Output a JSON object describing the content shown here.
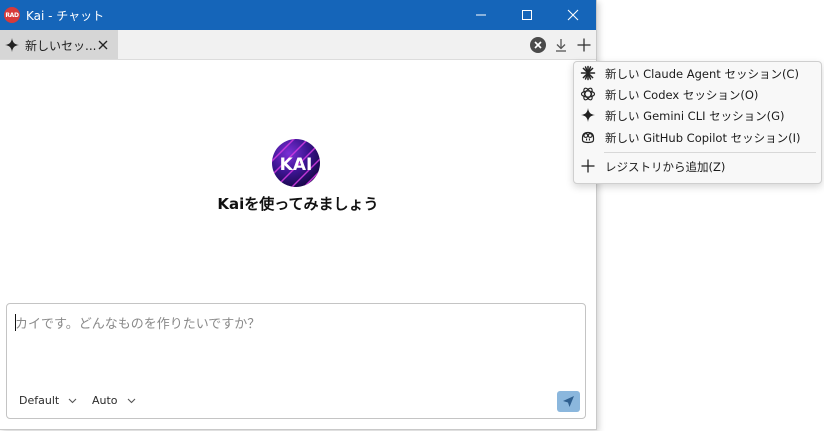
{
  "window": {
    "title": "Kai - チャット",
    "app_logo_text": "RAD",
    "titlebar_color": "#1565b9"
  },
  "tabs": [
    {
      "label": "新しいセッ...",
      "icon": "sparkle-icon",
      "active": true
    }
  ],
  "main": {
    "logo_text": "KAI",
    "headline": "Kaiを使ってみましょう"
  },
  "composer": {
    "placeholder": "カイです。どんなものを作りたいですか？",
    "value": "",
    "model_select": "Default",
    "mode_select": "Auto",
    "send_icon": "send-icon"
  },
  "menu": {
    "items": [
      {
        "label": "新しい Claude Agent セッション(C)",
        "icon": "claude-icon"
      },
      {
        "label": "新しい Codex セッション(O)",
        "icon": "openai-icon"
      },
      {
        "label": "新しい Gemini CLI セッション(G)",
        "icon": "gemini-icon"
      },
      {
        "label": "新しい GitHub Copilot セッション(I)",
        "icon": "copilot-icon"
      },
      {
        "label": "レジストリから追加(Z)",
        "icon": "plus-icon"
      }
    ]
  }
}
